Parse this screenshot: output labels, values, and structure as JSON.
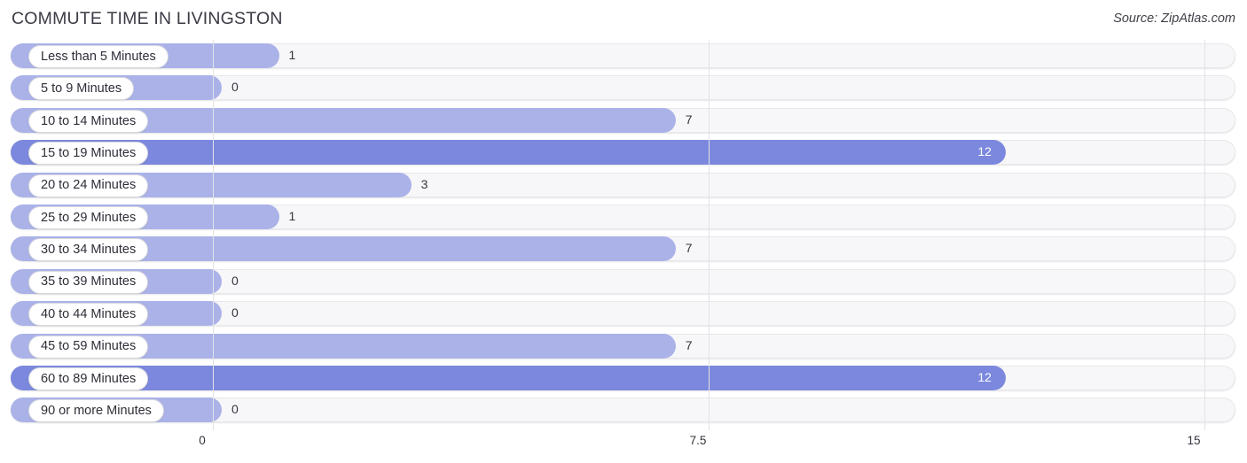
{
  "header": {
    "title": "COMMUTE TIME IN LIVINGSTON",
    "source": "Source: ZipAtlas.com"
  },
  "colors": {
    "bar_dark": "#7b88dd",
    "bar_light": "#aab2e8",
    "track_fill": "#f7f7f9",
    "track_border": "#e8e8ec",
    "gridline": "#e3e3e6",
    "text": "#34343e",
    "value_inside": "#ffffff"
  },
  "chart_data": {
    "type": "bar",
    "orientation": "horizontal",
    "title": "COMMUTE TIME IN LIVINGSTON",
    "xlabel": "",
    "ylabel": "",
    "xlim": [
      0,
      15
    ],
    "xticks": [
      0,
      7.5,
      15
    ],
    "xtick_labels": [
      "0",
      "7.5",
      "15"
    ],
    "grid": true,
    "legend": false,
    "categories": [
      "Less than 5 Minutes",
      "5 to 9 Minutes",
      "10 to 14 Minutes",
      "15 to 19 Minutes",
      "20 to 24 Minutes",
      "25 to 29 Minutes",
      "30 to 34 Minutes",
      "35 to 39 Minutes",
      "40 to 44 Minutes",
      "45 to 59 Minutes",
      "60 to 89 Minutes",
      "90 or more Minutes"
    ],
    "values": [
      1,
      0,
      7,
      12,
      3,
      1,
      7,
      0,
      0,
      7,
      12,
      0
    ],
    "value_labels": [
      "1",
      "0",
      "7",
      "12",
      "3",
      "1",
      "7",
      "0",
      "0",
      "7",
      "12",
      "0"
    ]
  },
  "rows": [
    {
      "label": "Less than 5 Minutes",
      "value": 1,
      "value_label": "1",
      "shade": "light",
      "label_inside": false
    },
    {
      "label": "5 to 9 Minutes",
      "value": 0,
      "value_label": "0",
      "shade": "light",
      "label_inside": false
    },
    {
      "label": "10 to 14 Minutes",
      "value": 7,
      "value_label": "7",
      "shade": "light",
      "label_inside": false
    },
    {
      "label": "15 to 19 Minutes",
      "value": 12,
      "value_label": "12",
      "shade": "dark",
      "label_inside": true
    },
    {
      "label": "20 to 24 Minutes",
      "value": 3,
      "value_label": "3",
      "shade": "light",
      "label_inside": false
    },
    {
      "label": "25 to 29 Minutes",
      "value": 1,
      "value_label": "1",
      "shade": "light",
      "label_inside": false
    },
    {
      "label": "30 to 34 Minutes",
      "value": 7,
      "value_label": "7",
      "shade": "light",
      "label_inside": false
    },
    {
      "label": "35 to 39 Minutes",
      "value": 0,
      "value_label": "0",
      "shade": "light",
      "label_inside": false
    },
    {
      "label": "40 to 44 Minutes",
      "value": 0,
      "value_label": "0",
      "shade": "light",
      "label_inside": false
    },
    {
      "label": "45 to 59 Minutes",
      "value": 7,
      "value_label": "7",
      "shade": "light",
      "label_inside": false
    },
    {
      "label": "60 to 89 Minutes",
      "value": 12,
      "value_label": "12",
      "shade": "dark",
      "label_inside": true
    },
    {
      "label": "90 or more Minutes",
      "value": 0,
      "value_label": "0",
      "shade": "light",
      "label_inside": false
    }
  ],
  "axis": {
    "ticks": [
      {
        "label": "0",
        "value": 0
      },
      {
        "label": "7.5",
        "value": 7.5
      },
      {
        "label": "15",
        "value": 15
      }
    ]
  }
}
